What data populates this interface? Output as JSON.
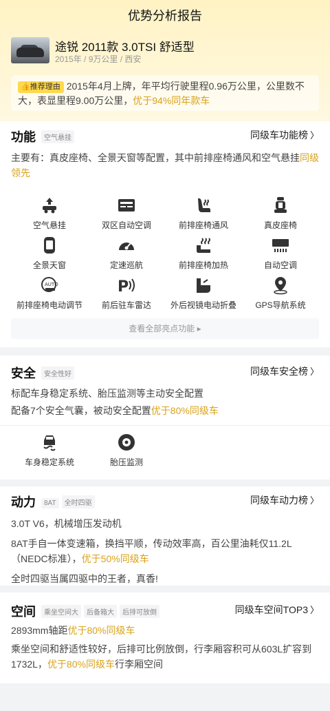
{
  "page_title": "优势分析报告",
  "car": {
    "name": "途锐 2011款 3.0TSI 舒适型",
    "meta": "2015年 / 9万公里 / 西安"
  },
  "reason": {
    "badge": "推荐理由",
    "text": "2015年4月上牌，年平均行驶里程0.96万公里，公里数不大，表显里程9.00万公里，",
    "highlight": "优于94%同年款车"
  },
  "function": {
    "title": "功能",
    "chips": [
      "空气悬挂"
    ],
    "rank": "同级车功能榜",
    "desc": "主要有：真皮座椅、全景天窗等配置，其中前排座椅通风和空气悬挂",
    "desc_hl": "同级领先",
    "features": [
      {
        "label": "空气悬挂",
        "icon": "air-suspension-icon"
      },
      {
        "label": "双区自动空调",
        "icon": "dual-zone-ac-icon"
      },
      {
        "label": "前排座椅通风",
        "icon": "seat-ventilation-icon"
      },
      {
        "label": "真皮座椅",
        "icon": "leather-seat-icon"
      },
      {
        "label": "全景天窗",
        "icon": "panoramic-sunroof-icon"
      },
      {
        "label": "定速巡航",
        "icon": "cruise-control-icon"
      },
      {
        "label": "前排座椅加热",
        "icon": "seat-heating-icon"
      },
      {
        "label": "自动空调",
        "icon": "auto-ac-icon"
      },
      {
        "label": "前排座椅电动调节",
        "icon": "power-seat-icon"
      },
      {
        "label": "前后驻车雷达",
        "icon": "parking-radar-icon"
      },
      {
        "label": "外后视镜电动折叠",
        "icon": "mirror-fold-icon"
      },
      {
        "label": "GPS导航系统",
        "icon": "gps-icon"
      }
    ],
    "all_button": "查看全部亮点功能"
  },
  "safety": {
    "title": "安全",
    "chips": [
      "安全性好"
    ],
    "rank": "同级车安全榜",
    "line1": "标配车身稳定系统、胎压监测等主动安全配置",
    "line2": "配备7个安全气囊，被动安全配置",
    "line2_hl": "优于80%同级车",
    "features": [
      {
        "label": "车身稳定系统",
        "icon": "stability-control-icon"
      },
      {
        "label": "胎压监测",
        "icon": "tire-pressure-icon"
      }
    ]
  },
  "power": {
    "title": "动力",
    "chips": [
      "8AT",
      "全时四驱"
    ],
    "rank": "同级车动力榜",
    "line1": "3.0T V6，机械增压发动机",
    "line2": "8AT手自一体变速箱，换挡平顺，传动效率高，百公里油耗仅11.2L（NEDC标准），",
    "line2_hl": "优于50%同级车",
    "line3": "全时四驱当属四驱中的王者，真香!"
  },
  "space": {
    "title": "空间",
    "chips": [
      "乘坐空间大",
      "后备箱大",
      "后排可放倒"
    ],
    "rank": "同级车空间TOP3",
    "line1": "2893mm轴距",
    "line1_hl": "优于80%同级车",
    "line2": "乘坐空间和舒适性较好，后排可比例放倒，行李厢容积可从603L扩容到1732L，",
    "line2_hl": "优于80%同级车",
    "line2_tail": "行李厢空间"
  },
  "colors": {
    "accent": "#d9a21a",
    "badge": "#ffd84d",
    "header_bg": "#fff3c4"
  }
}
